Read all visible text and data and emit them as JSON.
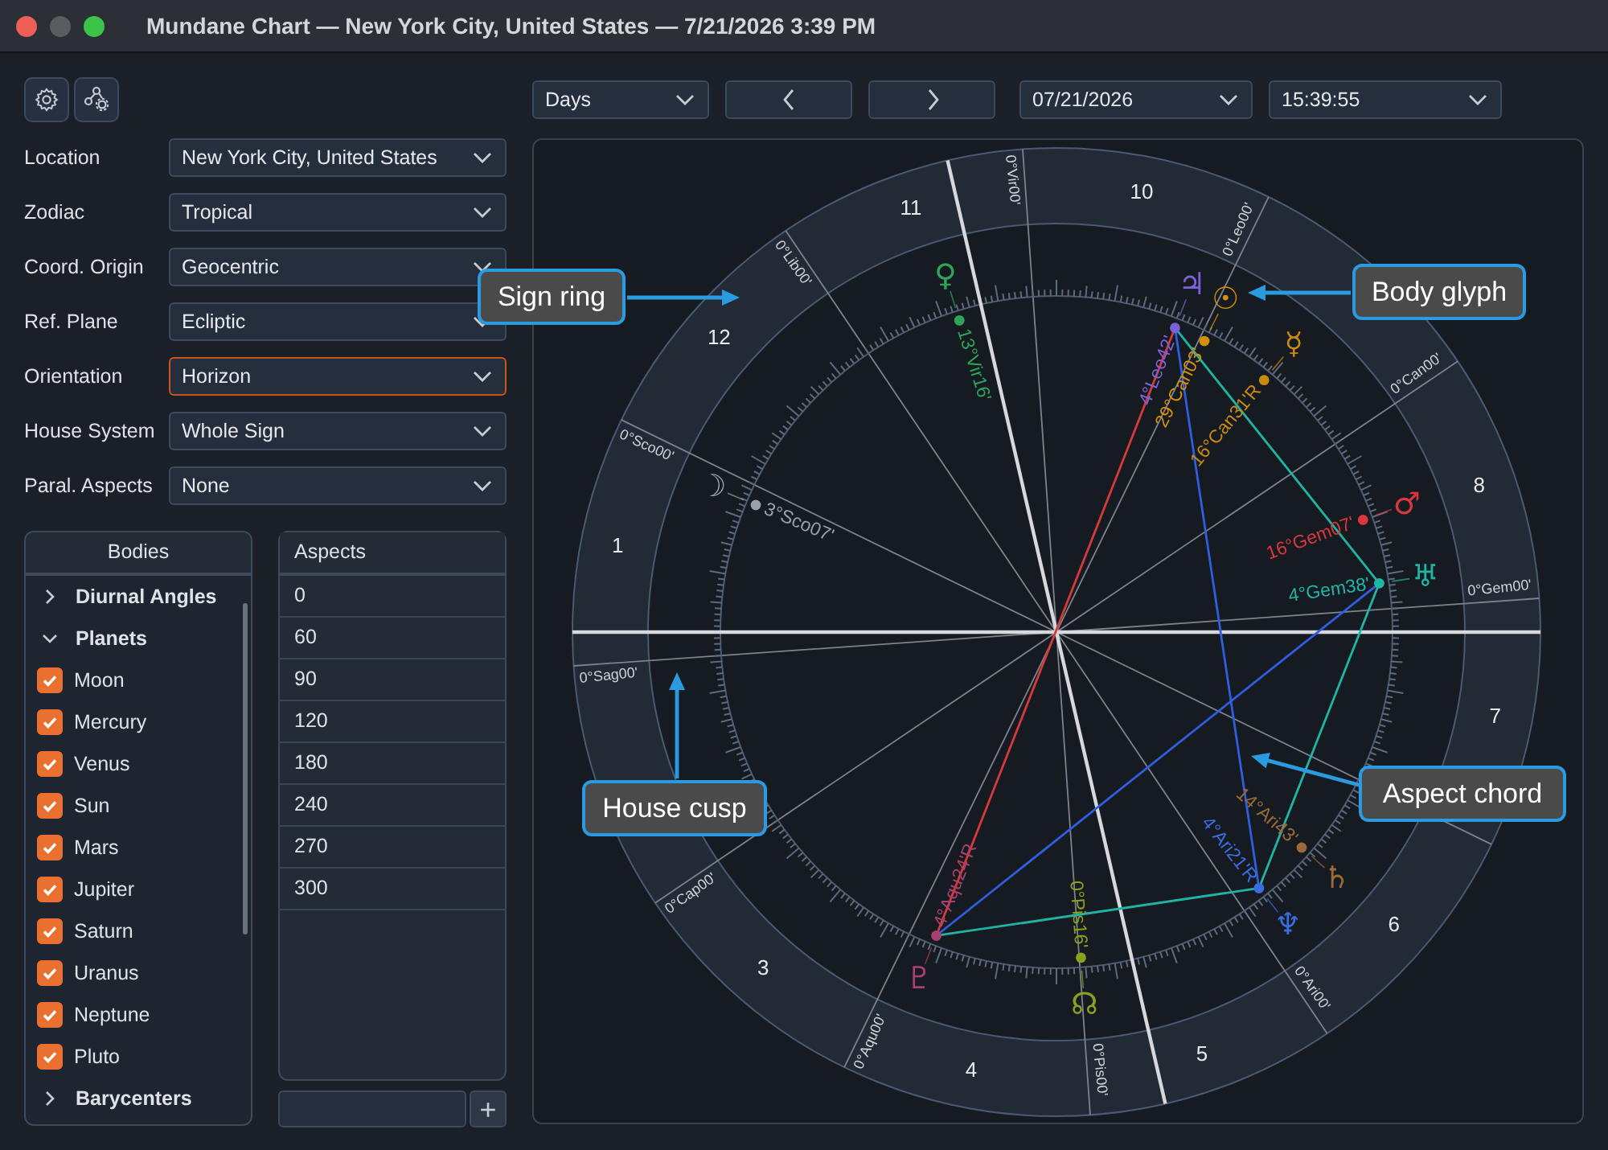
{
  "window": {
    "title": "Mundane Chart — New York City, United States — 7/21/2026 3:39 PM"
  },
  "settings": [
    {
      "label": "Location",
      "value": "New York City, United States",
      "focused": false
    },
    {
      "label": "Zodiac",
      "value": "Tropical",
      "focused": false
    },
    {
      "label": "Coord. Origin",
      "value": "Geocentric",
      "focused": false
    },
    {
      "label": "Ref. Plane",
      "value": "Ecliptic",
      "focused": false
    },
    {
      "label": "Orientation",
      "value": "Horizon",
      "focused": true
    },
    {
      "label": "House System",
      "value": "Whole Sign",
      "focused": false
    },
    {
      "label": "Paral. Aspects",
      "value": "None",
      "focused": false
    }
  ],
  "bodies": {
    "header": "Bodies",
    "items": [
      {
        "label": "Diurnal Angles",
        "expanded": false
      },
      {
        "label": "Planets",
        "expanded": true,
        "children": [
          {
            "label": "Moon",
            "checked": true
          },
          {
            "label": "Mercury",
            "checked": true
          },
          {
            "label": "Venus",
            "checked": true
          },
          {
            "label": "Sun",
            "checked": true
          },
          {
            "label": "Mars",
            "checked": true
          },
          {
            "label": "Jupiter",
            "checked": true
          },
          {
            "label": "Saturn",
            "checked": true
          },
          {
            "label": "Uranus",
            "checked": true
          },
          {
            "label": "Neptune",
            "checked": true
          },
          {
            "label": "Pluto",
            "checked": true
          }
        ]
      },
      {
        "label": "Barycenters",
        "expanded": false
      }
    ]
  },
  "aspects": {
    "header": "Aspects",
    "rows": [
      "0",
      "60",
      "90",
      "120",
      "180",
      "240",
      "270",
      "300"
    ],
    "add_button": "+"
  },
  "toolbar": {
    "period": "Days",
    "date": "07/21/2026",
    "time": "15:39:55"
  },
  "chart": {
    "houses": [
      "1",
      "3",
      "4",
      "5",
      "6",
      "7",
      "8",
      "10",
      "11",
      "12"
    ],
    "cusps": [
      "0°Sco00'",
      "0°Sag00'",
      "0°Cap00'",
      "0°Aqu00'",
      "0°Pis00'",
      "0°Ari00'",
      "0°Gem00'",
      "0°Can00'",
      "0°Leo00'",
      "0°Vir00'",
      "0°Lib00'"
    ],
    "bodies": [
      {
        "glyph": "☽",
        "position": "3°Sco07'",
        "color": "#9aa0a8"
      },
      {
        "glyph": "♀",
        "position": "13°Vir16'",
        "color": "#2fa35a"
      },
      {
        "glyph": "♃",
        "position": "4°Leo42'",
        "color": "#7b62d8"
      },
      {
        "glyph": "☉",
        "position": "29°Can03'",
        "color": "#d4900a"
      },
      {
        "glyph": "☿",
        "position": "16°Can31'R",
        "color": "#c98a10"
      },
      {
        "glyph": "♂",
        "position": "16°Gem07'",
        "color": "#d9363e"
      },
      {
        "glyph": "♅",
        "position": "4°Gem38'",
        "color": "#1fb5a6"
      },
      {
        "glyph": "♄",
        "position": "14°Ari43'",
        "color": "#9a6a3a"
      },
      {
        "glyph": "♆",
        "position": "4°Ari21'R",
        "color": "#3a6de0"
      },
      {
        "glyph": "☊",
        "position": "0°Pis16'",
        "color": "#8aa020"
      },
      {
        "glyph": "♇",
        "position": "4°Aqu24'R",
        "color": "#a8406e"
      }
    ],
    "aspects": [
      {
        "color": "#d63a3a"
      },
      {
        "color": "#2f5fe0"
      },
      {
        "color": "#2f5fe0"
      },
      {
        "color": "#1fb5a6"
      },
      {
        "color": "#1fb5a6"
      },
      {
        "color": "#1fb5a6"
      }
    ],
    "callouts": [
      "Sign ring",
      "Body glyph",
      "House cusp",
      "Aspect chord"
    ]
  }
}
